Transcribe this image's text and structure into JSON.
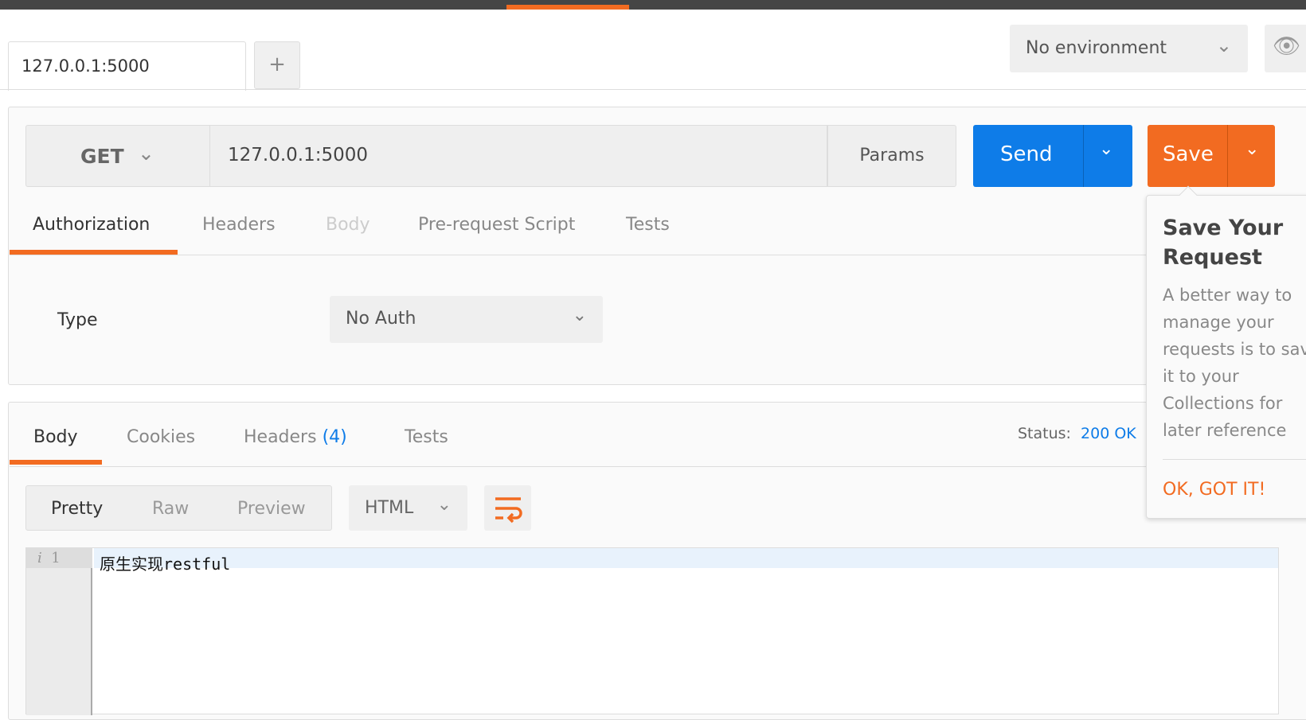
{
  "tabs": {
    "active": "127.0.0.1:5000",
    "add": "+"
  },
  "environment": {
    "selected": "No environment"
  },
  "request": {
    "method": "GET",
    "url": "127.0.0.1:5000",
    "params_label": "Params",
    "send_label": "Send",
    "save_label": "Save",
    "tabs": [
      "Authorization",
      "Headers",
      "Body",
      "Pre-request Script",
      "Tests"
    ],
    "auth": {
      "type_label": "Type",
      "type_value": "No Auth"
    }
  },
  "response": {
    "tabs": [
      "Body",
      "Cookies",
      "Headers",
      "Tests"
    ],
    "headers_count": "(4)",
    "status_label": "Status:",
    "status_value": "200 OK",
    "format_tabs": [
      "Pretty",
      "Raw",
      "Preview"
    ],
    "language": "HTML",
    "line_number": "1",
    "line_marker": "i",
    "body_line": "原生实现restful"
  },
  "popover": {
    "title": "Save Your Request",
    "body": "A better way to manage your requests is to save it to your Collections for later reference",
    "ok_label": "OK, GOT IT!"
  },
  "colors": {
    "accent": "#f26b21",
    "send": "#0e7ce8"
  }
}
